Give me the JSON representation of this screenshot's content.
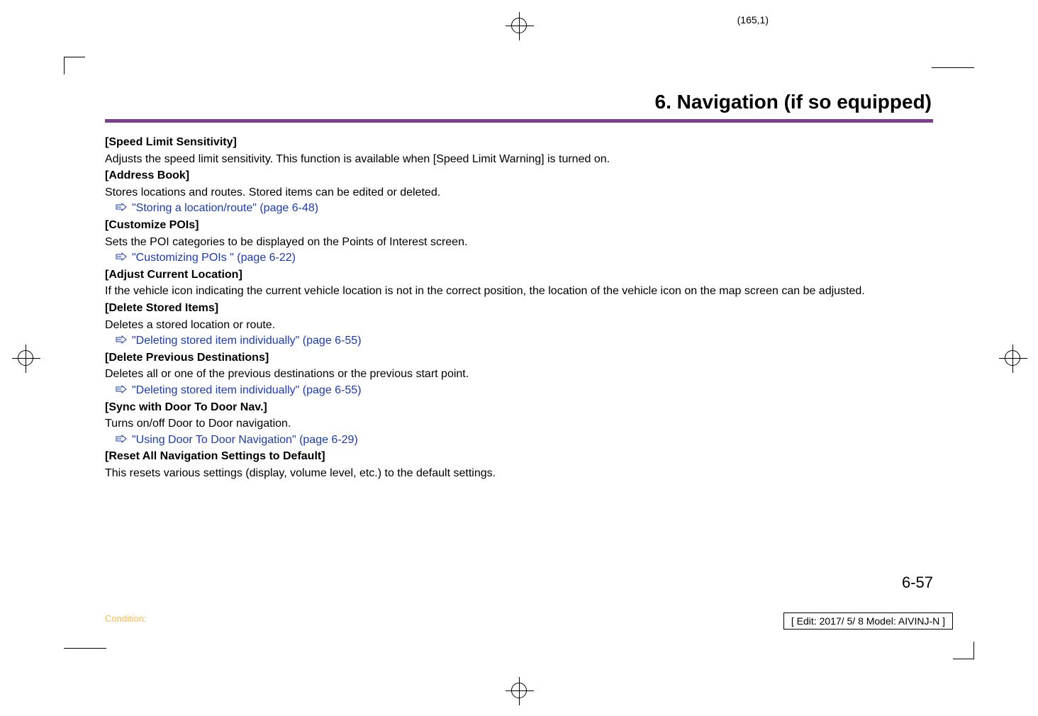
{
  "pageCoord": "(165,1)",
  "chapterTitle": "6. Navigation (if so equipped)",
  "sections": [
    {
      "head": "[Speed Limit Sensitivity]",
      "body": "Adjusts the speed limit sensitivity. This function is available when [Speed Limit Warning] is turned on.",
      "link": null
    },
    {
      "head": "[Address Book]",
      "body": "Stores locations and routes. Stored items can be edited or deleted.",
      "link": "\"Storing a location/route\" (page 6-48)"
    },
    {
      "head": "[Customize POIs]",
      "body": "Sets the POI categories to be displayed on the Points of Interest screen.",
      "link": "\"Customizing POIs \" (page 6-22)"
    },
    {
      "head": "[Adjust Current Location]",
      "body": "If the vehicle icon indicating the current vehicle location is not in the correct position, the location of the vehicle icon on the map screen can be adjusted.",
      "link": null
    },
    {
      "head": "[Delete Stored Items]",
      "body": "Deletes a stored location or route.",
      "link": "\"Deleting stored item individually\" (page 6-55)"
    },
    {
      "head": "[Delete Previous Destinations]",
      "body": "Deletes all or one of the previous destinations or the previous start point.",
      "link": "\"Deleting stored item individually\" (page 6-55)"
    },
    {
      "head": "[Sync with Door To Door Nav.]",
      "body": "Turns on/off Door to Door navigation.",
      "link": "\"Using Door To Door Navigation\" (page 6-29)"
    },
    {
      "head": "[Reset All Navigation Settings to Default]",
      "body": "This resets various settings (display, volume level, etc.) to the default settings.",
      "link": null
    }
  ],
  "pageNum": "6-57",
  "condition": "Condition:",
  "editBox": "[ Edit: 2017/ 5/ 8    Model: AIVINJ-N ]"
}
